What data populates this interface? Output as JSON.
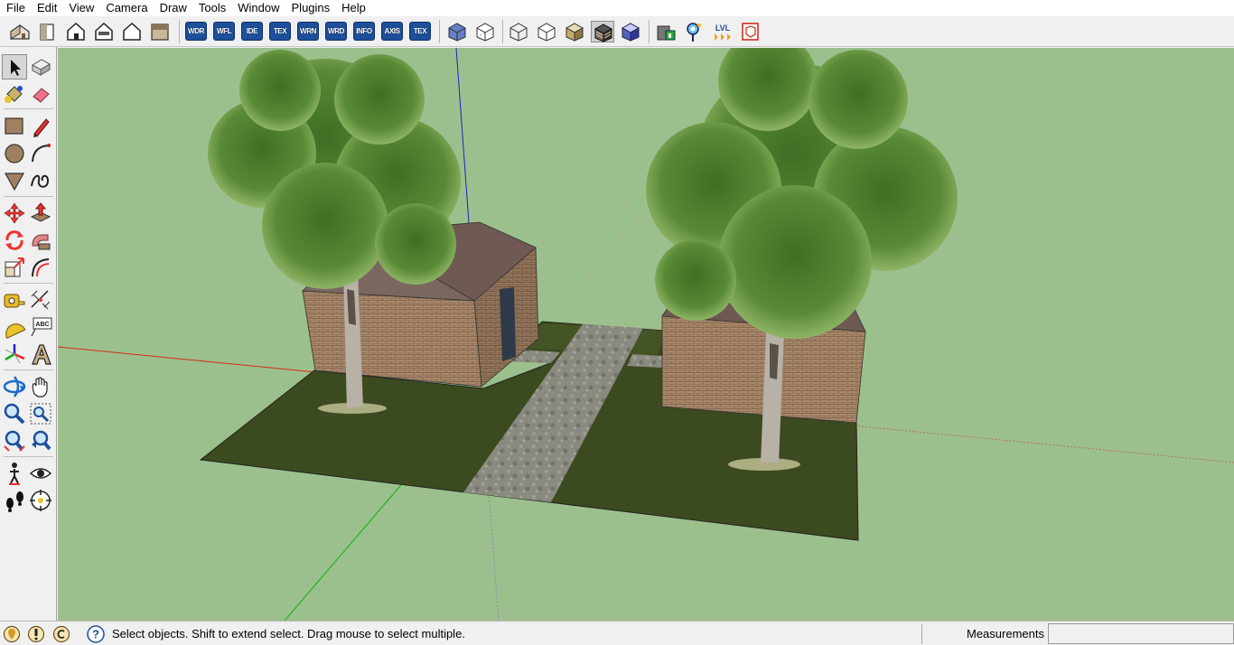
{
  "menubar": {
    "items": [
      {
        "label": "File"
      },
      {
        "label": "Edit"
      },
      {
        "label": "View"
      },
      {
        "label": "Camera"
      },
      {
        "label": "Draw"
      },
      {
        "label": "Tools"
      },
      {
        "label": "Window"
      },
      {
        "label": "Plugins"
      },
      {
        "label": "Help"
      }
    ]
  },
  "toolbar": {
    "views": [
      "iso-view-icon",
      "top-view-icon",
      "front-view-icon",
      "right-view-icon",
      "back-view-icon",
      "left-view-icon"
    ],
    "plugin_buttons": [
      {
        "label": "WDR"
      },
      {
        "label": "WFL"
      },
      {
        "label": "IDE"
      },
      {
        "label": "TEX"
      },
      {
        "label": "WRN"
      },
      {
        "label": "WRD"
      },
      {
        "label": "INFO"
      },
      {
        "label": "AXIS"
      },
      {
        "label": "TEX"
      }
    ],
    "styles": [
      "xray-icon",
      "back-edges-icon",
      "wireframe-icon",
      "hidden-line-icon",
      "shaded-icon",
      "shaded-with-textures-icon",
      "monochrome-icon"
    ],
    "extras": [
      "building-tool-icon",
      "search-pin-icon",
      "level-icon",
      "section-icon"
    ],
    "level_label": "LVL"
  },
  "palette": {
    "tools": [
      "select-arrow-icon",
      "make-component-icon",
      "paint-bucket-icon",
      "eraser-icon",
      "rectangle-icon",
      "line-pencil-icon",
      "circle-icon",
      "arc-icon",
      "polygon-icon",
      "freehand-icon",
      "move-icon",
      "push-pull-icon",
      "rotate-icon",
      "follow-me-icon",
      "scale-icon",
      "offset-icon",
      "tape-measure-icon",
      "dimension-icon",
      "protractor-icon",
      "text-label-icon",
      "axes-icon",
      "3d-text-icon",
      "orbit-icon",
      "pan-icon",
      "zoom-icon",
      "zoom-window-icon",
      "zoom-extents-icon",
      "previous-view-icon",
      "walk-icon",
      "look-around-icon",
      "footprints-icon",
      "section-plane-icon"
    ],
    "text_tool_label": "ABC"
  },
  "scene": {
    "background_color": "#9cc08d",
    "axis_colors": {
      "red": "#d12b1c",
      "green": "#1fb51f",
      "blue": "#2020c0"
    },
    "ground_color": "#3c4a1f",
    "path_color": "#8a8a80",
    "wall_color": "#a8876a",
    "roof_color": "#6e5a52",
    "door_color": "#2f3a48",
    "foliage_color": "#5a8a36"
  },
  "statusbar": {
    "icons": [
      "geo-location-icon",
      "credits-icon",
      "copyright-icon",
      "help-icon"
    ],
    "message": "Select objects. Shift to extend select. Drag mouse to select multiple.",
    "measurements_label": "Measurements",
    "measurements_value": ""
  }
}
